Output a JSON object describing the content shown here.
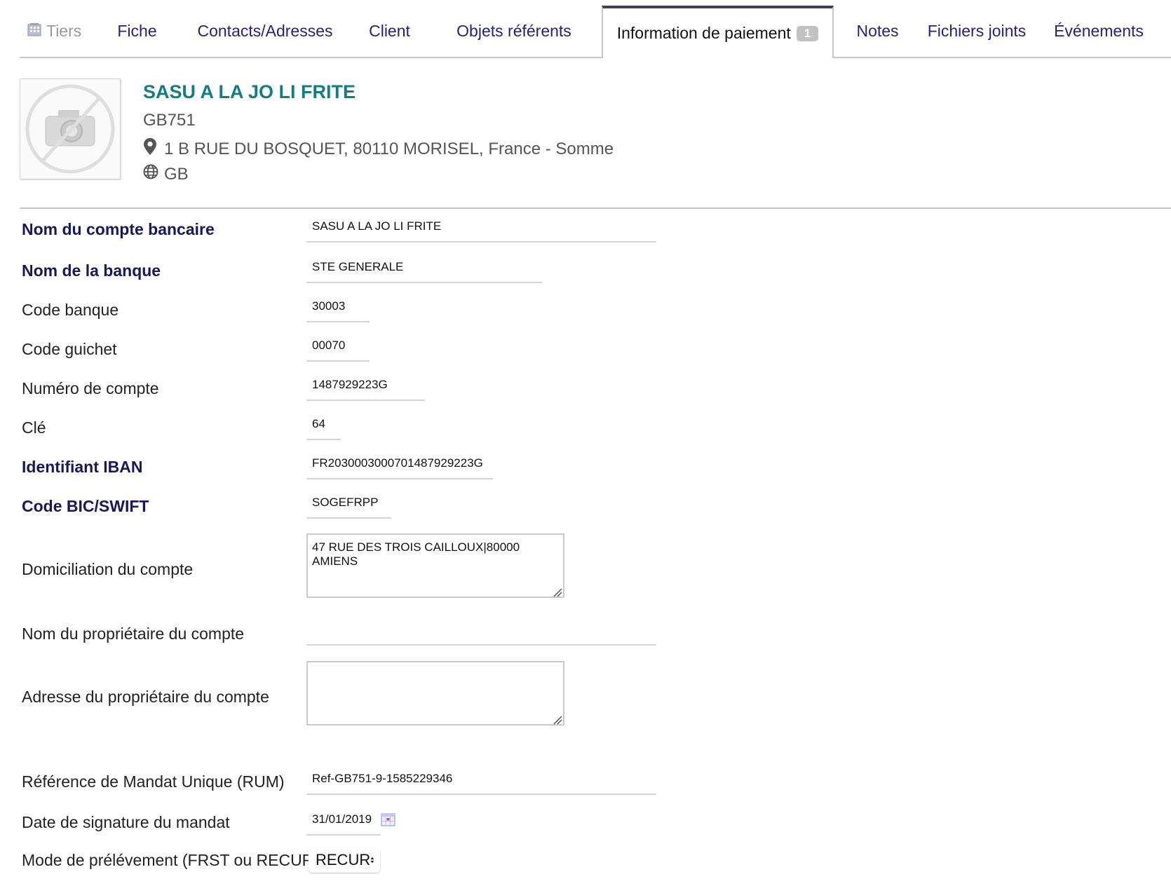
{
  "tabs": [
    {
      "label": "Tiers"
    },
    {
      "label": "Fiche"
    },
    {
      "label": "Contacts/Adresses"
    },
    {
      "label": "Client"
    },
    {
      "label": "Objets référents"
    },
    {
      "label": "Information de paiement",
      "badge": "1"
    },
    {
      "label": "Notes"
    },
    {
      "label": "Fichiers joints"
    },
    {
      "label": "Événements"
    }
  ],
  "company": {
    "name": "SASU A LA JO LI FRITE",
    "code": "GB751",
    "address": "1 B RUE DU BOSQUET, 80110 MORISEL, France - Somme",
    "country": "GB"
  },
  "form": {
    "account_name": {
      "label": "Nom du compte bancaire",
      "value": "SASU A LA JO LI FRITE"
    },
    "bank_name": {
      "label": "Nom de la banque",
      "value": "STE GENERALE"
    },
    "bank_code": {
      "label": "Code banque",
      "value": "30003"
    },
    "branch_code": {
      "label": "Code guichet",
      "value": "00070"
    },
    "account_number": {
      "label": "Numéro de compte",
      "value": "1487929223G"
    },
    "key": {
      "label": "Clé",
      "value": "64"
    },
    "iban": {
      "label": "Identifiant IBAN",
      "value": "FR2030003000701487929223G"
    },
    "bic": {
      "label": "Code BIC/SWIFT",
      "value": "SOGEFRPP"
    },
    "domiciliation": {
      "label": "Domiciliation du compte",
      "value": "47 RUE DES TROIS CAILLOUX|80000 AMIENS"
    },
    "owner_name": {
      "label": "Nom du propriétaire du compte",
      "value": ""
    },
    "owner_address": {
      "label": "Adresse du propriétaire du compte",
      "value": ""
    },
    "rum": {
      "label": "Référence de Mandat Unique (RUM)",
      "value": "Ref-GB751-9-1585229346"
    },
    "mandate_date": {
      "label": "Date de signature du mandat",
      "value": "31/01/2019"
    },
    "debit_mode": {
      "label": "Mode de prélévement (FRST ou RECUR)",
      "value": "RECUR"
    }
  },
  "colors": {
    "tab_text": "#23237a",
    "company_name": "#137d82",
    "required_label": "#17175c",
    "active_tab_border": "#3d4256"
  }
}
